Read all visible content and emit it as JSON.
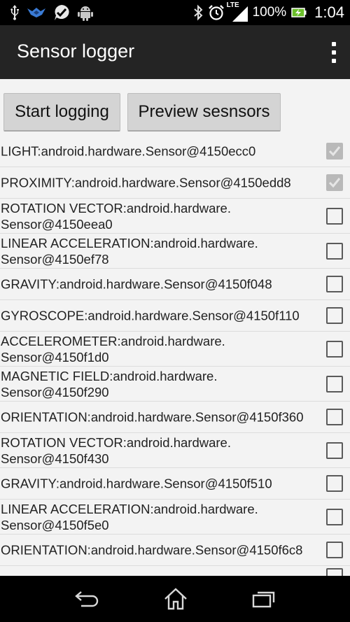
{
  "status_bar": {
    "battery_percent": "100%",
    "time": "1:04",
    "network_type": "LTE",
    "icons": [
      "usb-icon",
      "bird-icon",
      "check-bubble-icon",
      "android-icon",
      "bluetooth-icon",
      "alarm-icon",
      "signal-icon",
      "battery-charging-icon"
    ]
  },
  "app_bar": {
    "title": "Sensor logger",
    "overflow_icon": "overflow-menu-icon"
  },
  "buttons": {
    "start": "Start logging",
    "preview": "Preview sesnsors"
  },
  "sensors": [
    {
      "label": "LIGHT:android.hardware.Sensor@4150ecc0",
      "checked": true
    },
    {
      "label": "PROXIMITY:android.hardware.Sensor@4150edd8",
      "checked": true
    },
    {
      "label": "ROTATION VECTOR:android.hardware.\nSensor@4150eea0",
      "checked": false
    },
    {
      "label": "LINEAR ACCELERATION:android.hardware.\nSensor@4150ef78",
      "checked": false
    },
    {
      "label": "GRAVITY:android.hardware.Sensor@4150f048",
      "checked": false
    },
    {
      "label": "GYROSCOPE:android.hardware.Sensor@4150f110",
      "checked": false
    },
    {
      "label": "ACCELEROMETER:android.hardware.\nSensor@4150f1d0",
      "checked": false
    },
    {
      "label": "MAGNETIC FIELD:android.hardware.\nSensor@4150f290",
      "checked": false
    },
    {
      "label": "ORIENTATION:android.hardware.Sensor@4150f360",
      "checked": false
    },
    {
      "label": "ROTATION VECTOR:android.hardware.\nSensor@4150f430",
      "checked": false
    },
    {
      "label": "GRAVITY:android.hardware.Sensor@4150f510",
      "checked": false
    },
    {
      "label": "LINEAR ACCELERATION:android.hardware.\nSensor@4150f5e0",
      "checked": false
    },
    {
      "label": "ORIENTATION:android.hardware.Sensor@4150f6c8",
      "checked": false
    },
    {
      "label": "",
      "checked": false
    }
  ],
  "nav_bar": {
    "icons": [
      "back-icon",
      "home-icon",
      "recent-apps-icon"
    ]
  }
}
